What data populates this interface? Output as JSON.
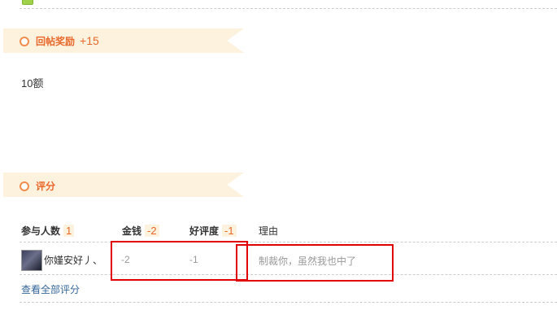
{
  "reply_reward": {
    "title": "回帖奖励",
    "bonus": "+15"
  },
  "post": {
    "content": "10额"
  },
  "rating": {
    "title": "评分",
    "headers": {
      "participants_label": "参与人数",
      "participants_count": "1",
      "money_label": "金钱",
      "money_total": "-2",
      "reputation_label": "好评度",
      "reputation_total": "-1",
      "reason_label": "理由"
    },
    "rows": [
      {
        "user": "你嫤安好丿、",
        "money": "-2",
        "reputation": "-1",
        "reason": "制裁你，虽然我也中了"
      }
    ],
    "view_all": "查看全部评分"
  },
  "colors": {
    "accent": "#e8682c",
    "banner_bg": "#fdf2dd",
    "link": "#336699",
    "highlight_box": "#e00000"
  }
}
